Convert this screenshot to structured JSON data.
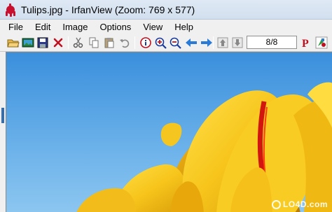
{
  "window": {
    "title": "Tulips.jpg - IrfanView (Zoom: 769 x 577)",
    "app_icon": "irfanview-cat-icon"
  },
  "menu": [
    "File",
    "Edit",
    "Image",
    "Options",
    "View",
    "Help"
  ],
  "toolbar": {
    "buttons": [
      "open-folder-icon",
      "slideshow-icon",
      "save-icon",
      "delete-icon",
      "cut-icon",
      "copy-icon",
      "paste-icon",
      "undo-icon",
      "info-icon",
      "zoom-in-icon",
      "zoom-out-icon",
      "previous-arrow-icon",
      "next-arrow-icon",
      "first-page-icon",
      "last-page-icon",
      "print-icon",
      "paint-icon"
    ],
    "page_counter": "8/8"
  },
  "image": {
    "subject": "yellow tulips against blue sky",
    "sky_color": "#5aa3e0",
    "petal_color": "#f5c21b"
  },
  "watermark": "LO4D.com"
}
